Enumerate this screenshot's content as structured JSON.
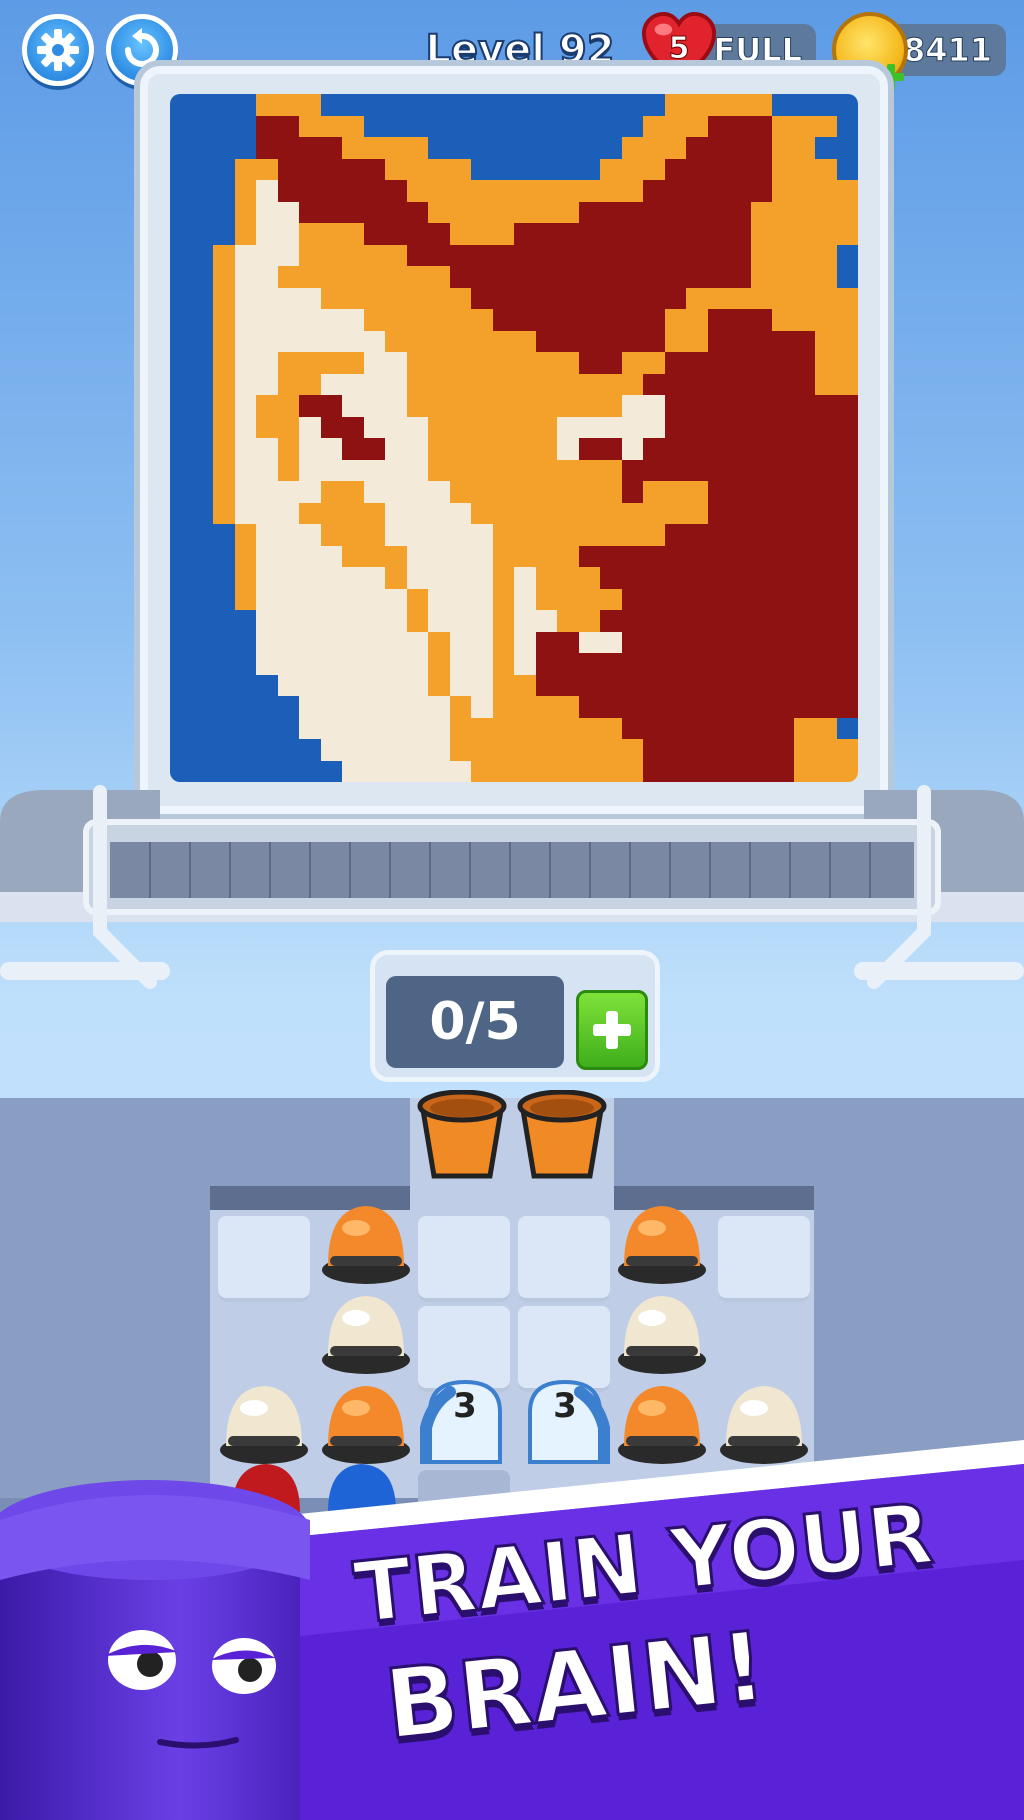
{
  "hud": {
    "level_label": "Level 92",
    "lives_count": "5",
    "lives_status": "FULL",
    "coins": "8411",
    "settings_icon": "gear-icon",
    "restart_icon": "undo-icon"
  },
  "picture": {
    "palette": {
      "b": "#1c5fb9",
      "o": "#f4a12b",
      "r": "#8e1212",
      "w": "#f3ead9"
    },
    "rows": [
      "bbbbooobbbbbbbbbbbbbbbbooooobbbb",
      "bbbbrrooobbbbbbbbbbbbbooorrrooob",
      "bbbbrrrroooobbbbbbbbbooorrrroobb",
      "bbboorrrrroooobbbbbbooorrrrrooob",
      "bbbowrrrrrrooooooooooorrrrrroooo",
      "bbbowwrrrrrrooooooorrrrrrrrooooo",
      "bbbowwooorrrrooorrrrrrrrrrrooooo",
      "bbowwwooooorrrrrrrrrrrrrrrroooob",
      "bbowwoooooooorrrrrrrrrrrrrroooob",
      "bbowwwwooooooorrrrrrrrrroooooooo",
      "bbowwwwwwoooooorrrrrrrroorrroooo",
      "bbowwwwwwwooooooorrrrrroorrrrroo",
      "bbowwoooowwoooooooorroorrrrrrroo",
      "bbowwoowwwwooooooooooorrrrrrrroo",
      "bbowoorrwwwoooooooooowwrrrrrrrrr",
      "bbowoowrrwwwoooooowwwwwrrrrrrrrr",
      "bbowwowwrrwwoooooowrrwrrrrrrrrrr",
      "bbowwowwwwwwooooooooorrrrrrrrrrr",
      "bbowwwwoowwwwoooooooorooorrrrrrr",
      "bbowwwoooowwwwooooooooooorrrrrrr",
      "bbbowwwooowwwwwoooooooorrrrrrrrr",
      "bbbowwwwooowwwwoooorrrrrrrrrrrrr",
      "bbbowwwwwwowwwwowooorrrrrrrrrrrr",
      "bbbowwwwwwwowwwowoooorrrrrrrrrrr",
      "bbbbwwwwwwwowwwowwoorrrrrrrrrrrr",
      "bbbbwwwwwwwwowwowrrwwrrrrrrrrrrr",
      "bbbbwwwwwwwwowwowrrrrrrrrrrrrrrr",
      "bbbbbwwwwwwwowwoorrrrrrrrrrrrrrr",
      "bbbbbbwwwwwwwowoooorrrrrrrrrrrrr",
      "bbbbbbwwwwwwwoooooooorrrrrrrroob",
      "bbbbbbbwwwwwwooooooooorrrrrrrooo",
      "bbbbbbbbwwwwwwoooooooorrrrrrrooo"
    ]
  },
  "holder": {
    "counter": "0/5",
    "add_icon": "plus-icon"
  },
  "board": {
    "front_cups": [
      "orange",
      "orange"
    ],
    "stacks": [
      {
        "column": "left-outer",
        "hats": [
          "cream"
        ]
      },
      {
        "column": "left-inner",
        "hats": [
          "orange",
          "cream",
          "orange"
        ]
      },
      {
        "column": "right-inner",
        "hats": [
          "orange",
          "cream",
          "orange"
        ]
      },
      {
        "column": "right-outer",
        "hats": [
          "cream"
        ]
      }
    ],
    "tunnels": [
      {
        "count": "3"
      },
      {
        "count": "3"
      }
    ]
  },
  "banner": {
    "line1": "TRAIN YOUR",
    "line2": "BRAIN!"
  },
  "colors": {
    "orange_hat": "#f3892b",
    "cream_hat": "#f1e6d0",
    "accent_green": "#56c527",
    "banner_purple": "#5a22d6"
  }
}
